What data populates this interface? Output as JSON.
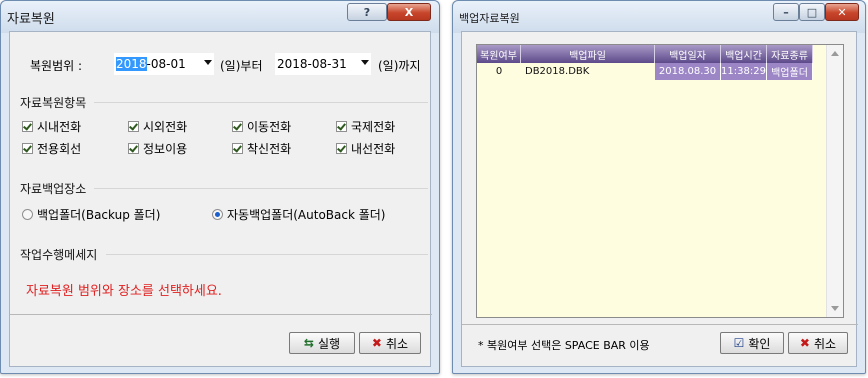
{
  "restore_dialog": {
    "title": "자료복원",
    "title_buttons": {
      "help": "?",
      "close": "X"
    },
    "range": {
      "label": "복원범위 :",
      "from_date_selected": "2018",
      "from_date_rest": "-08-01",
      "from_day": "(일)부터",
      "to_date": "2018-08-31",
      "to_day": "(일)까지"
    },
    "items_group": {
      "title": "자료복원항목",
      "checkboxes": [
        "시내전화",
        "시외전화",
        "이동전화",
        "국제전화",
        "전용회선",
        "정보이용",
        "착신전화",
        "내선전화"
      ]
    },
    "location_group": {
      "title": "자료백업장소",
      "option_backup": "백업폴더(Backup 폴더)",
      "option_autoback": "자동백업폴더(AutoBack 폴더)",
      "selected": "autoback"
    },
    "message_group": {
      "title": "작업수행메세지",
      "message": "자료복원 범위와 장소를 선택하세요.",
      "message_color": "#e02020"
    },
    "buttons": {
      "run": "실행",
      "cancel": "취소"
    }
  },
  "backup_restore_window": {
    "title": "백업자료복원",
    "grid": {
      "columns": [
        "복원여부",
        "백업파일",
        "백업일자",
        "백업시간",
        "자료종류"
      ],
      "rows": [
        [
          "0",
          "DB2018.DBK",
          "2018.08.30",
          "11:38:29",
          "백업폴더"
        ]
      ],
      "header_color": "#6b5896",
      "highlight_color": "#9c86c6",
      "background_color": "#fffde0"
    },
    "hint": "* 복원여부 선택은 SPACE BAR 이용",
    "buttons": {
      "ok": "확인",
      "cancel": "취소"
    }
  }
}
